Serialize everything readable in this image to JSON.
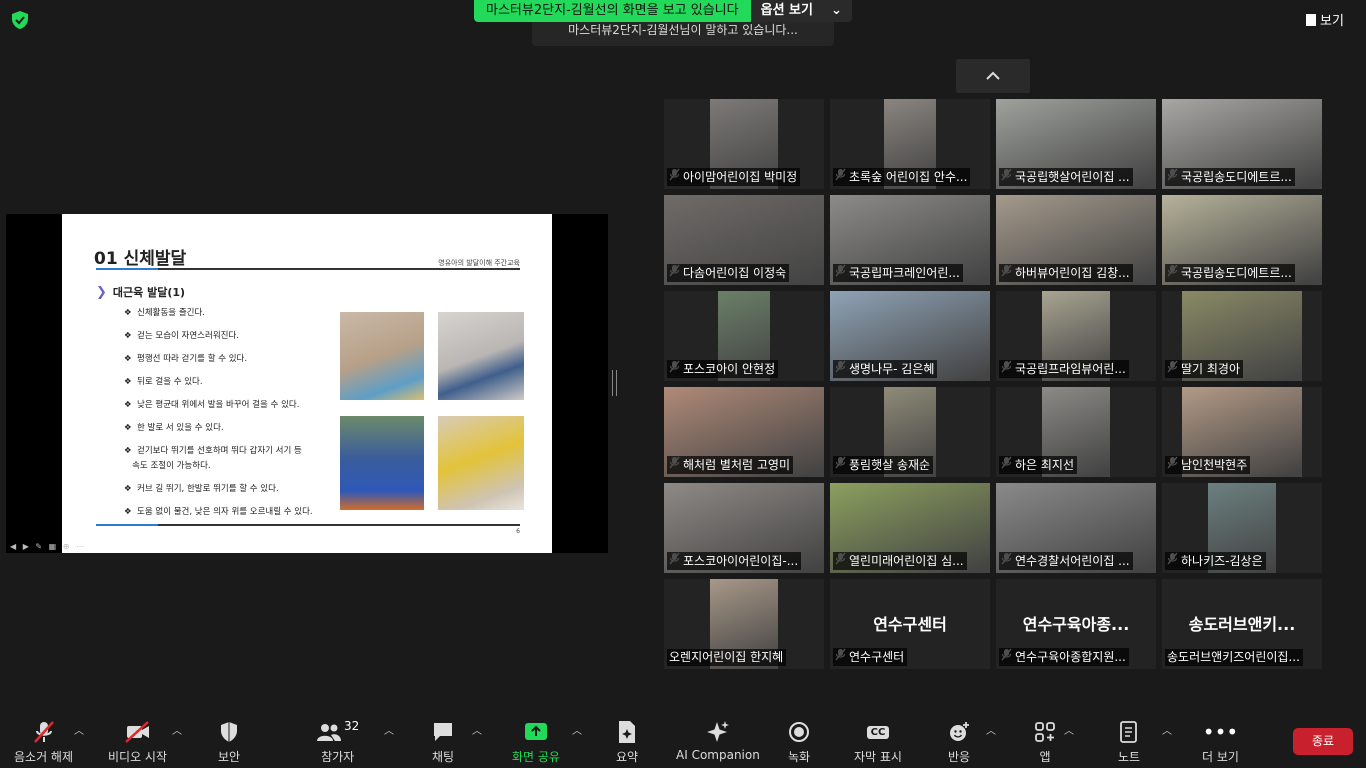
{
  "share_banner": {
    "text": "마스터뷰2단지-김월선의 화면을 보고 있습니다",
    "options_label": "옵션 보기",
    "speaking_text": "마스터뷰2단지-김월선님이 말하고 있습니다..."
  },
  "view_label": "보기",
  "slide": {
    "title": "01 신체발달",
    "subtitle": "영유아의 발달이해 주간교육",
    "section": "대근육 발달(1)",
    "bullets": [
      "신체활동을 즐긴다.",
      "걷는 모습이 자연스러워진다.",
      "평행선 따라 걷기를 할 수 있다.",
      "뒤로 걸을 수 있다.",
      "낮은 평균대 위에서 발을 바꾸어 걸을 수 있다.",
      "한 발로 서 있을 수 있다.",
      "걷기보다 뛰기를 선호하며 뛰다 갑자기 서기 등",
      "속도 조절이 가능하다.",
      "커브 길 뛰기, 한발로 뛰기를 할 수 있다.",
      "도움 없이 물건, 낮은 의자 위를 오르내릴 수 있다."
    ],
    "page": "6"
  },
  "participants": [
    {
      "name": "아이맘어린이집 박미정",
      "muted": true,
      "bg": "#7d7a78"
    },
    {
      "name": "초록숲 어린이집 안수...",
      "muted": true,
      "bg": "#8a8580"
    },
    {
      "name": "국공립햇살어린이집 ...",
      "muted": true,
      "bg": "#9ea19c"
    },
    {
      "name": "국공립송도디에트르...",
      "muted": true,
      "bg": "#a8a7a4"
    },
    {
      "name": "다솜어린이집 이정숙",
      "muted": true,
      "bg": "#6f6b68"
    },
    {
      "name": "국공립파크레인어린...",
      "muted": true,
      "bg": "#8c8b89"
    },
    {
      "name": "하버뷰어린이집 김창...",
      "muted": true,
      "bg": "#a49a8c"
    },
    {
      "name": "국공립송도디에트르...",
      "muted": true,
      "bg": "#b6b29a"
    },
    {
      "name": "포스코아이 안현정",
      "muted": true,
      "bg": "#6b8068"
    },
    {
      "name": "생명나무- 김은혜",
      "muted": true,
      "bg": "#8fa3b6"
    },
    {
      "name": "국공립프라임뷰어린...",
      "muted": true,
      "bg": "#a9a592"
    },
    {
      "name": "딸기 최경아",
      "muted": true,
      "bg": "#8a8a66"
    },
    {
      "name": "해처럼 별처럼 고영미",
      "muted": true,
      "bg": "#b08a78"
    },
    {
      "name": "풍림햇살 송재순",
      "muted": true,
      "bg": "#8f8b78"
    },
    {
      "name": "하은 최지선",
      "muted": true,
      "bg": "#8b8a86"
    },
    {
      "name": "남인천박현주",
      "muted": true,
      "bg": "#b39a86"
    },
    {
      "name": "포스코아이어린이집-...",
      "muted": true,
      "bg": "#8f8a86"
    },
    {
      "name": "열린미래어린이집 심...",
      "muted": true,
      "bg": "#8ca05e"
    },
    {
      "name": "연수경찰서어린이집 ...",
      "muted": true,
      "bg": "#8a8a8a"
    },
    {
      "name": "하나키즈-김상은",
      "muted": true,
      "bg": "#6c8080"
    },
    {
      "name": "오렌지어린이집 한지혜",
      "muted": false,
      "bg": "#a89888"
    },
    {
      "name": "연수구센터",
      "muted": true,
      "big": "연수구센터"
    },
    {
      "name": "연수구육아종합지원...",
      "muted": true,
      "big": "연수구육아종..."
    },
    {
      "name": "송도러브앤키즈어린이집...",
      "muted": false,
      "big": "송도러브앤키..."
    }
  ],
  "toolbar": {
    "mute": "음소거 해제",
    "video": "비디오 시작",
    "security": "보안",
    "participants": "참가자",
    "participants_count": "32",
    "chat": "채팅",
    "share": "화면 공유",
    "summary": "요약",
    "ai": "AI Companion",
    "record": "녹화",
    "captions": "자막 표시",
    "captions_icon": "CC",
    "reactions": "반응",
    "apps": "앱",
    "notes": "노트",
    "more": "더 보기",
    "end": "종료"
  },
  "colors": {
    "accent_green": "#23d959",
    "end_red": "#c9202e",
    "mute_red": "#e0262b"
  }
}
